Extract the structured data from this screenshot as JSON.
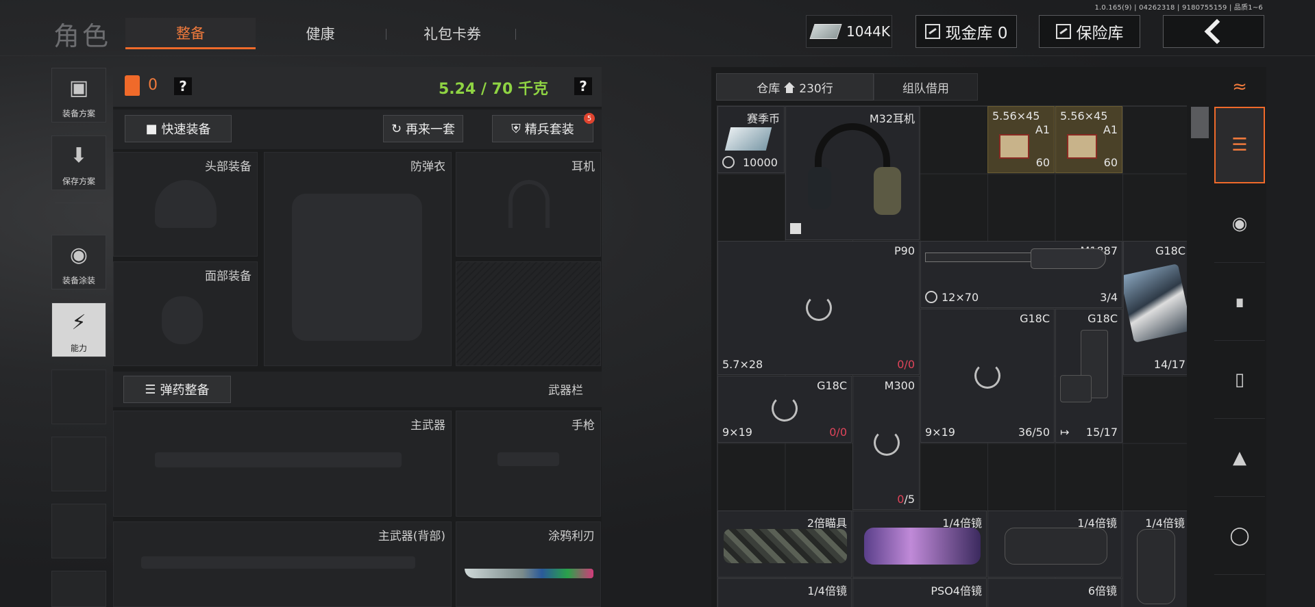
{
  "version": "1.0.165(9) | 04262318 | 9180755159 | 品质1~6",
  "header": {
    "page_title": "角色",
    "tabs": [
      {
        "label": "整备",
        "active": true
      },
      {
        "label": "健康",
        "active": false
      },
      {
        "label": "礼包卡券",
        "active": false
      }
    ],
    "money": "1044K",
    "cash_vault_label": "现金库 0",
    "safe_label": "保险库"
  },
  "left_rail": [
    {
      "label": "装备方案",
      "icon": "vest-icon"
    },
    {
      "label": "保存方案",
      "icon": "download-icon"
    },
    {
      "label": "装备涂装",
      "icon": "helmet-paint-icon"
    },
    {
      "label": "能力",
      "icon": "lightning-icon",
      "active": true
    }
  ],
  "loadout": {
    "armor_value": "0",
    "help": "?",
    "weight": "5.24 / 70 千克",
    "quick_equip": "快速装备",
    "again_label": "再来一套",
    "elite_label": "精兵套装",
    "elite_badge": "5",
    "slots": {
      "head": "头部装备",
      "vest": "防弹衣",
      "headset": "耳机",
      "face": "面部装备"
    },
    "ammo_label": "弹药整备",
    "weapons_bar": "武器栏",
    "weapon_slots": {
      "primary": "主武器",
      "pistol": "手枪",
      "primary_back": "主武器(背部)",
      "melee": "涂鸦利刃"
    }
  },
  "warehouse": {
    "tab_main": "仓库",
    "rows": "230行",
    "tab_team": "组队借用",
    "items": [
      {
        "name": "赛季币",
        "value": "10000"
      },
      {
        "name": "M32耳机"
      },
      {
        "name": "5.56×45",
        "sub": "A1",
        "count": "60"
      },
      {
        "name": "5.56×45",
        "sub": "A1",
        "count": "60"
      },
      {
        "name": "P90",
        "caliber": "5.7×28",
        "ammo": "0/0"
      },
      {
        "name": "M1887",
        "caliber": "12×70",
        "ammo": "3/4"
      },
      {
        "name": "G18C",
        "ammo": "14/17"
      },
      {
        "name": "G18C",
        "caliber": "9×19",
        "ammo": "36/50"
      },
      {
        "name": "G18C",
        "ammo": "15/17"
      },
      {
        "name": "G18C",
        "caliber": "9×19",
        "ammo": "0/0"
      },
      {
        "name": "M300",
        "ammo": "0/5"
      },
      {
        "name": "2倍瞄具"
      },
      {
        "name": "1/4倍镜"
      },
      {
        "name": "1/4倍镜"
      },
      {
        "name": "1/4倍镜"
      },
      {
        "name": "1/4倍镜"
      },
      {
        "name": "PSO4倍镜"
      },
      {
        "name": "6倍镜"
      }
    ]
  },
  "categories": [
    {
      "icon": "stack-refresh-icon"
    },
    {
      "icon": "layers-icon",
      "active": true
    },
    {
      "icon": "helmet-icon"
    },
    {
      "icon": "rifle-icon"
    },
    {
      "icon": "magazine-icon"
    },
    {
      "icon": "bullet-icon"
    },
    {
      "icon": "scope-icon"
    }
  ],
  "colors": {
    "accent": "#f06a2a",
    "weight_green": "#8fd443",
    "ammo_red": "#e0445a",
    "gold_item": "#4a4128"
  }
}
